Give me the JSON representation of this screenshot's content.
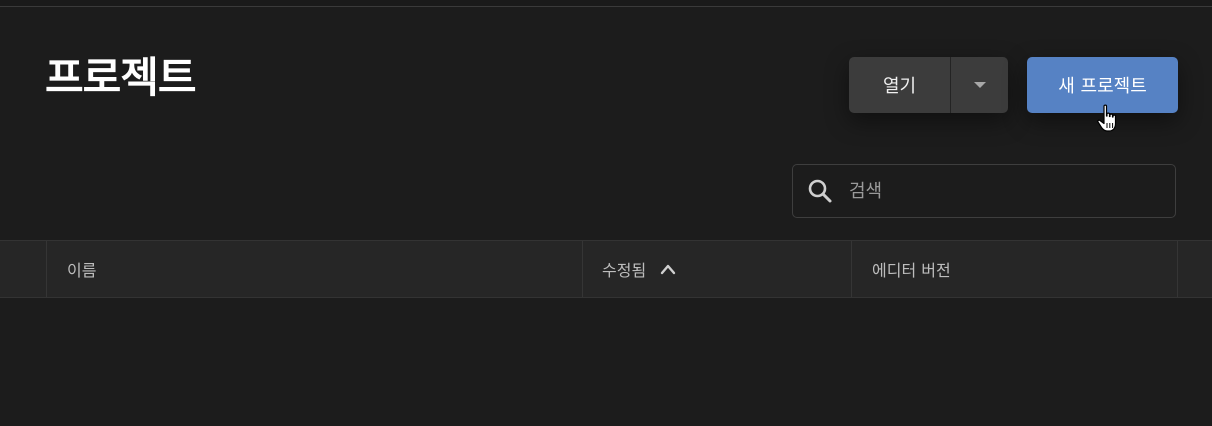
{
  "header": {
    "title": "프로젝트"
  },
  "toolbar": {
    "open_label": "열기",
    "new_project_label": "새 프로젝트"
  },
  "search": {
    "placeholder": "검색",
    "value": ""
  },
  "table": {
    "columns": [
      {
        "label": "이름"
      },
      {
        "label": "수정됨",
        "sort": "ascending"
      },
      {
        "label": "에디터 버전"
      }
    ],
    "rows": []
  },
  "colors": {
    "background": "#1c1c1c",
    "accent": "#5682c4",
    "secondary_button": "#3c3c3c"
  }
}
